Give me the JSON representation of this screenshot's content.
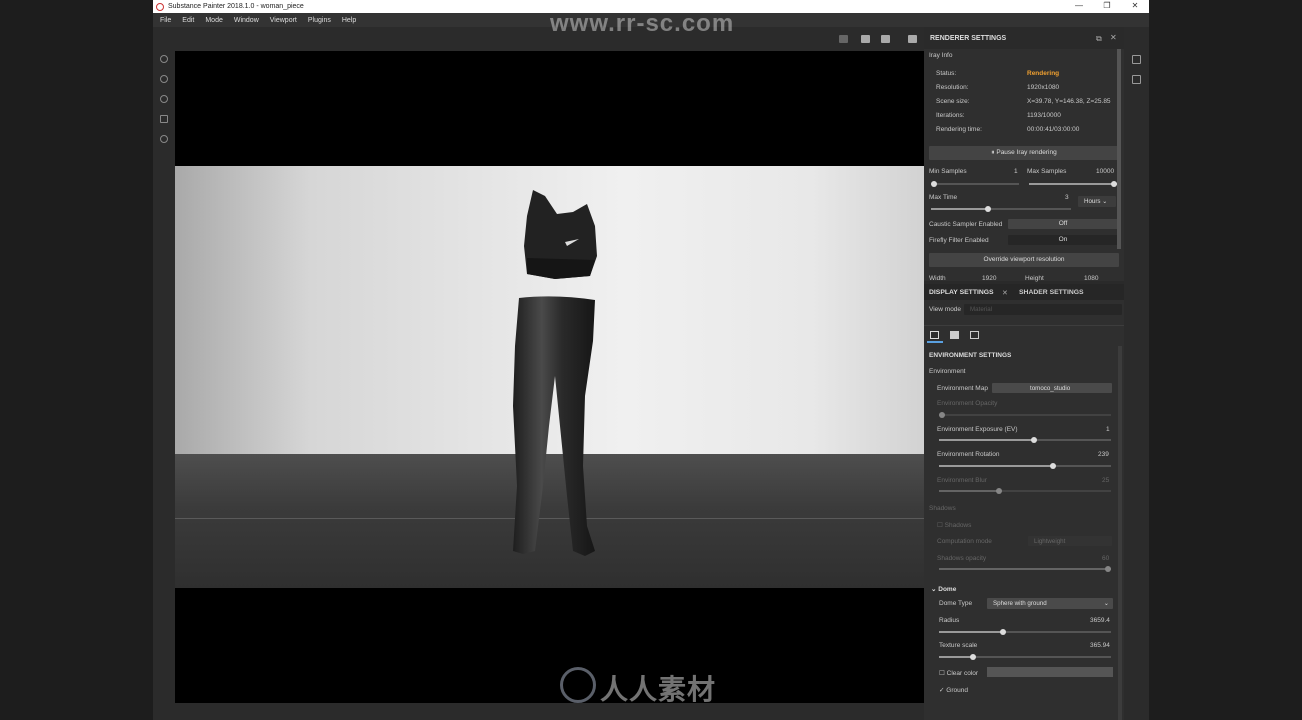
{
  "app": {
    "title": "Substance Painter 2018.1.0 - woman_piece",
    "window_buttons": [
      "—",
      "❐",
      "✕"
    ]
  },
  "menu": [
    "File",
    "Edit",
    "Mode",
    "Window",
    "Viewport",
    "Plugins",
    "Help"
  ],
  "watermark": {
    "url": "www.rr-sc.com",
    "brand": "人人素材"
  },
  "renderer": {
    "title": "RENDERER SETTINGS",
    "iray_info": "Iray Info",
    "status_label": "Status:",
    "status_value": "Rendering",
    "resolution_label": "Resolution:",
    "resolution_value": "1920x1080",
    "scene_size_label": "Scene size:",
    "scene_size_value": "X=39.78, Y=146.38, Z=25.85",
    "iterations_label": "Iterations:",
    "iterations_value": "1193/10000",
    "rendering_time_label": "Rendering time:",
    "rendering_time_value": "00:00:41/03:00:00",
    "pause_button": "⏸ Pause Iray rendering",
    "min_samples_label": "Min Samples",
    "min_samples_value": "1",
    "max_samples_label": "Max Samples",
    "max_samples_value": "10000",
    "max_time_label": "Max Time",
    "max_time_value": "3",
    "max_time_unit": "Hours",
    "caustic_label": "Caustic Sampler Enabled",
    "caustic_value": "Off",
    "firefly_label": "Firefly Filter Enabled",
    "firefly_value": "On",
    "override_button": "Override viewport resolution",
    "width_label": "Width",
    "width_value": "1920",
    "height_label": "Height",
    "height_value": "1080"
  },
  "display": {
    "tab_display": "DISPLAY SETTINGS",
    "tab_shader": "SHADER SETTINGS",
    "view_mode_label": "View mode",
    "view_mode_value": "Material",
    "env_settings_title": "ENVIRONMENT SETTINGS",
    "environment_label": "Environment",
    "env_map_label": "Environment Map",
    "env_map_value": "tomoco_studio",
    "env_opacity_label": "Environment Opacity",
    "env_exposure_label": "Environment Exposure (EV)",
    "env_exposure_value": "1",
    "env_rotation_label": "Environment Rotation",
    "env_rotation_value": "239",
    "env_blur_label": "Environment Blur",
    "env_blur_value": "25",
    "shadows_label": "Shadows",
    "shadows_check_label": "Shadows",
    "computation_mode_label": "Computation mode",
    "computation_mode_value": "Lightweight",
    "shadows_opacity_label": "Shadows opacity",
    "shadows_opacity_value": "60",
    "dome_label": "Dome",
    "dome_type_label": "Dome Type",
    "dome_type_value": "Sphere with ground",
    "radius_label": "Radius",
    "radius_value": "3659.4",
    "texture_scale_label": "Texture scale",
    "texture_scale_value": "365.94",
    "clear_color_label": "Clear color",
    "ground_label": "Ground"
  },
  "levels": {
    "min_samples": 0.0,
    "max_samples": 1.0,
    "max_time": 0.41,
    "env_opacity": 0.0,
    "env_exposure": 0.55,
    "env_rotation": 0.66,
    "env_blur": 0.35,
    "shadows_opacity": 1.0,
    "radius": 0.37,
    "texture_scale": 0.2
  }
}
